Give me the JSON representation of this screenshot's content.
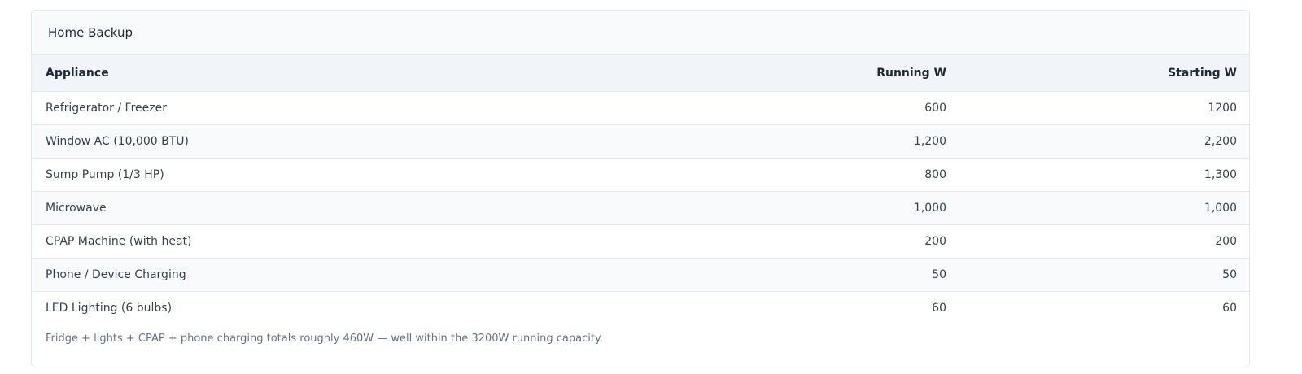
{
  "card": {
    "title": "Home Backup"
  },
  "table": {
    "headers": {
      "appliance": "Appliance",
      "running": "Running W",
      "starting": "Starting W"
    },
    "rows": [
      {
        "appliance": "Refrigerator / Freezer",
        "running": "600",
        "starting": "1200"
      },
      {
        "appliance": "Window AC (10,000 BTU)",
        "running": "1,200",
        "starting": "2,200"
      },
      {
        "appliance": "Sump Pump (1/3 HP)",
        "running": "800",
        "starting": "1,300"
      },
      {
        "appliance": "Microwave",
        "running": "1,000",
        "starting": "1,000"
      },
      {
        "appliance": "CPAP Machine (with heat)",
        "running": "200",
        "starting": "200"
      },
      {
        "appliance": "Phone / Device Charging",
        "running": "50",
        "starting": "50"
      },
      {
        "appliance": "LED Lighting (6 bulbs)",
        "running": "60",
        "starting": "60"
      }
    ]
  },
  "footnote": "Fridge + lights + CPAP + phone charging totals roughly 460W — well within the 3200W running capacity."
}
